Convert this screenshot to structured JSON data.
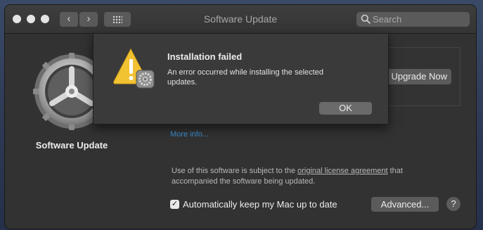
{
  "window": {
    "title": "Software Update",
    "search_placeholder": "Search"
  },
  "nav": {
    "back_glyph": "‹",
    "forward_glyph": "›"
  },
  "icons": {
    "app": "gear-icon",
    "warning": "warning-triangle-icon",
    "search": "search-icon",
    "grid": "grid-icon"
  },
  "main": {
    "app_label": "Software Update",
    "upgrade_button": "Upgrade Now",
    "more_info": "More info...",
    "license_prefix": "Use of this software is subject to the ",
    "license_link": "original license agreement",
    "license_suffix": " that accompanied the software being updated.",
    "auto_update_label": "Automatically keep my Mac up to date",
    "auto_update_checked": true,
    "advanced_button": "Advanced...",
    "help_button": "?"
  },
  "dialog": {
    "title": "Installation failed",
    "message": "An error occurred while installing the selected updates.",
    "ok_button": "OK"
  },
  "colors": {
    "link": "#3e8ed0",
    "warning": "#f1c232"
  }
}
